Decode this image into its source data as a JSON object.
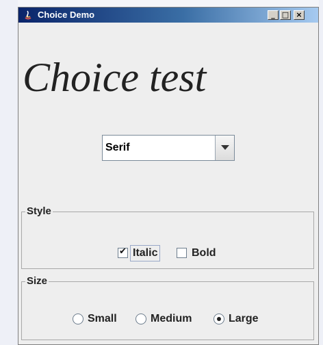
{
  "window": {
    "title": "Choice Demo",
    "controls": {
      "minimize": "_",
      "maximize": "□",
      "close": "×"
    }
  },
  "heading": "Choice test",
  "font_combo": {
    "selected": "Serif"
  },
  "style_group": {
    "label": "Style",
    "italic": {
      "label": "Italic",
      "checked": true
    },
    "bold": {
      "label": "Bold",
      "checked": false
    }
  },
  "size_group": {
    "label": "Size",
    "options": [
      {
        "label": "Small",
        "selected": false
      },
      {
        "label": "Medium",
        "selected": false
      },
      {
        "label": "Large",
        "selected": true
      }
    ]
  },
  "icons": {
    "app": "java-app-icon",
    "check": "check-mark-icon",
    "dropdown": "chevron-down-icon"
  },
  "colors": {
    "title_gradient_start": "#0a246a",
    "title_gradient_end": "#a6caf0",
    "window_bg": "#eeeeee"
  }
}
